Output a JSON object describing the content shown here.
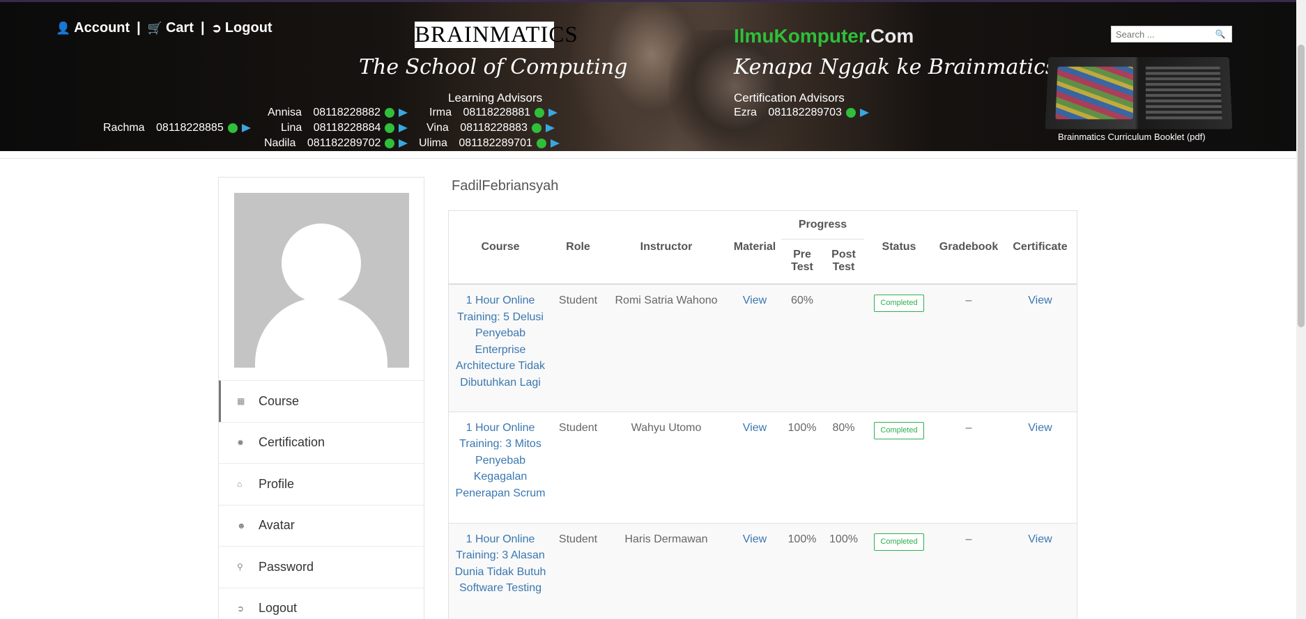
{
  "header": {
    "links": [
      {
        "label": "Account",
        "icon": "user-icon"
      },
      {
        "label": "Cart",
        "icon": "cart-icon"
      },
      {
        "label": "Logout",
        "icon": "logout-icon"
      }
    ],
    "separator": "|",
    "brand": "BRAINMATICS",
    "tagline_left": "The School of Computing",
    "site_name_green": "IlmuKomputer",
    "site_name_white": ".Com",
    "tagline_right": "Kenapa Nggak ke Brainmatics Aja?",
    "learning_advisors_title": "Learning Advisors",
    "certification_advisors_title": "Certification Advisors",
    "advisors": [
      {
        "name": "Rachma",
        "phone": "08118228885"
      },
      {
        "name": "Annisa",
        "phone": "08118228882"
      },
      {
        "name": "Lina",
        "phone": "08118228884"
      },
      {
        "name": "Nadila",
        "phone": "081182289702"
      },
      {
        "name": "Irma",
        "phone": "08118228881"
      },
      {
        "name": "Vina",
        "phone": "08118228883"
      },
      {
        "name": "Ulima",
        "phone": "081182289701"
      },
      {
        "name": "Ezra",
        "phone": "081182289703"
      }
    ],
    "search_placeholder": "Search ...",
    "booklet_caption": "Brainmatics Curriculum Booklet (pdf)"
  },
  "sidebar": {
    "menu": [
      {
        "label": "Course",
        "icon": "book-icon"
      },
      {
        "label": "Certification",
        "icon": "certificate-icon"
      },
      {
        "label": "Profile",
        "icon": "home-icon"
      },
      {
        "label": "Avatar",
        "icon": "user-circle-icon"
      },
      {
        "label": "Password",
        "icon": "key-icon"
      },
      {
        "label": "Logout",
        "icon": "logout-icon"
      }
    ]
  },
  "main": {
    "username": "FadilFebriansyah",
    "table": {
      "headers": {
        "course": "Course",
        "role": "Role",
        "instructor": "Instructor",
        "material": "Material",
        "progress": "Progress",
        "pre_test": "Pre Test",
        "post_test": "Post Test",
        "status": "Status",
        "gradebook": "Gradebook",
        "certificate": "Certificate"
      },
      "rows": [
        {
          "course": "1 Hour Online Training: 5 Delusi Penyebab Enterprise Architecture Tidak Dibutuhkan Lagi",
          "role": "Student",
          "instructor": "Romi Satria Wahono",
          "material": "View",
          "pre_test": "60%",
          "post_test": "",
          "status": "Completed",
          "gradebook": "–",
          "certificate": "View"
        },
        {
          "course": "1 Hour Online Training: 3 Mitos Penyebab Kegagalan Penerapan Scrum",
          "role": "Student",
          "instructor": "Wahyu Utomo",
          "material": "View",
          "pre_test": "100%",
          "post_test": "80%",
          "status": "Completed",
          "gradebook": "–",
          "certificate": "View"
        },
        {
          "course": "1 Hour Online Training: 3 Alasan Dunia Tidak Butuh Software Testing",
          "role": "Student",
          "instructor": "Haris Dermawan",
          "material": "View",
          "pre_test": "100%",
          "post_test": "100%",
          "status": "Completed",
          "gradebook": "–",
          "certificate": "View"
        }
      ]
    }
  },
  "colors": {
    "link": "#3a77b0",
    "completed_badge": "#2fae4e",
    "whatsapp": "#2fbf3a",
    "telegram": "#3aa6e0"
  }
}
